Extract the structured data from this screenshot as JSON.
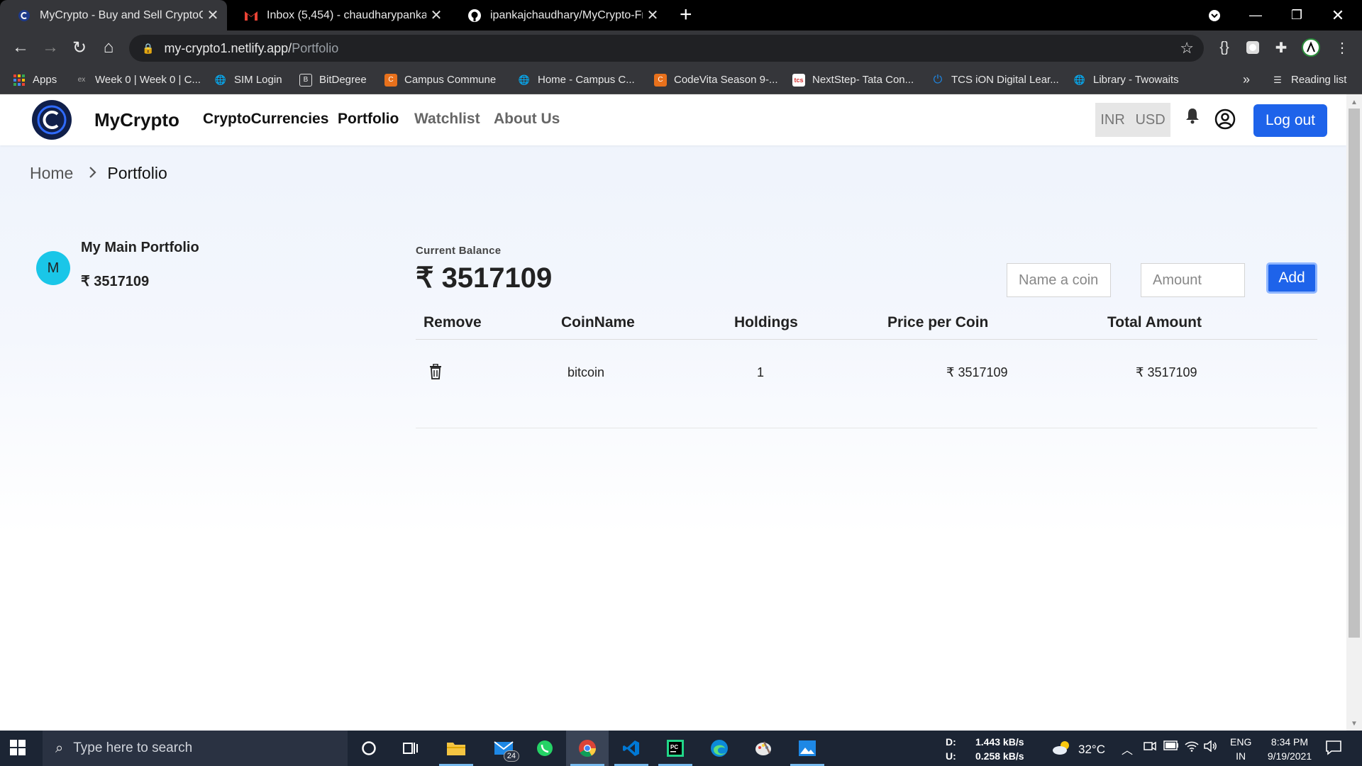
{
  "browser": {
    "tabs": [
      {
        "title": "MyCrypto - Buy and Sell CryptoC",
        "active": true
      },
      {
        "title": "Inbox (5,454) - chaudharypankaja",
        "active": false
      },
      {
        "title": "ipankajchaudhary/MyCrypto-Fro",
        "active": false
      }
    ],
    "url_host": "my-crypto1.netlify.app/",
    "url_path": "Portfolio",
    "bookmarks": [
      "Apps",
      "Week 0 | Week 0 | C...",
      "SIM Login",
      "BitDegree",
      "Campus Commune",
      "Home - Campus C...",
      "CodeVita Season 9-...",
      "NextStep- Tata Con...",
      "TCS iON Digital Lear...",
      "Library - Twowaits"
    ],
    "more_bookmarks": "»",
    "reading_list": "Reading list"
  },
  "app": {
    "brand": "MyCrypto",
    "nav": [
      "CryptoCurrencies",
      "Portfolio",
      "Watchlist",
      "About Us"
    ],
    "currency": [
      "INR",
      "USD"
    ],
    "logout": "Log out",
    "breadcrumb": {
      "home": "Home",
      "current": "Portfolio"
    },
    "portfolio": {
      "avatar_letter": "M",
      "name": "My Main Portfolio",
      "balance": "₹ 3517109"
    },
    "current_balance": {
      "label": "Current Balance",
      "value": "₹ 3517109"
    },
    "form": {
      "coin_placeholder": "Name a coin",
      "amount_placeholder": "Amount",
      "add_label": "Add"
    },
    "table": {
      "headers": [
        "Remove",
        "CoinName",
        "Holdings",
        "Price per Coin",
        "Total Amount"
      ],
      "rows": [
        {
          "coin": "bitcoin",
          "holdings": "1",
          "price": "₹ 3517109",
          "total": "₹ 3517109"
        }
      ]
    }
  },
  "taskbar": {
    "search_placeholder": "Type here to search",
    "mail_badge": "24",
    "net_down_label": "D:",
    "net_down": "1.443 kB/s",
    "net_up_label": "U:",
    "net_up": "0.258 kB/s",
    "temperature": "32°C",
    "lang1": "ENG",
    "lang2": "IN",
    "time": "8:34 PM",
    "date": "9/19/2021"
  },
  "colors": {
    "accent": "#1e63ea",
    "avatar": "#1ac6e8",
    "chrome_dark": "#35363a",
    "taskbar": "#1c2534"
  }
}
